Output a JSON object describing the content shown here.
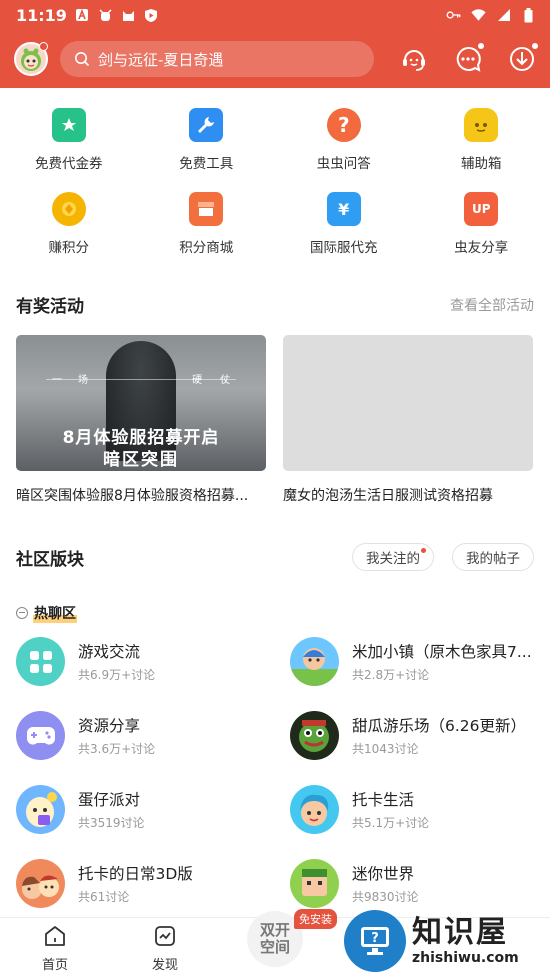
{
  "status": {
    "time": "11:19"
  },
  "search": {
    "placeholder": "剑与远征-夏日奇遇"
  },
  "quick_items": [
    {
      "label": "免费代金券",
      "color": "#26c28a"
    },
    {
      "label": "免费工具",
      "color": "#2f8ef2"
    },
    {
      "label": "虫虫问答",
      "color": "#f26a3d"
    },
    {
      "label": "辅助箱",
      "color": "#f5c518"
    },
    {
      "label": "赚积分",
      "color": "#f5b400"
    },
    {
      "label": "积分商城",
      "color": "#f2703d"
    },
    {
      "label": "国际服代充",
      "color": "#2f9df2"
    },
    {
      "label": "虫友分享",
      "color": "#f2603d"
    }
  ],
  "activities": {
    "title": "有奖活动",
    "view_all": "查看全部活动",
    "items": [
      {
        "caption": "暗区突围体验服8月体验服资格招募...",
        "poster_headline": "8月体验服招募开启",
        "poster_game": "暗区突围",
        "poster_chars": [
          "一",
          "场",
          "硬",
          "仗"
        ]
      },
      {
        "caption": "魔女的泡汤生活日服测试资格招募"
      }
    ]
  },
  "community": {
    "title": "社区版块",
    "pill_following": "我关注的",
    "pill_posts": "我的帖子",
    "hot_label": "热聊区",
    "forums": [
      {
        "name": "游戏交流",
        "meta": "共6.9万+讨论"
      },
      {
        "name": "米加小镇（原木色家具7...",
        "meta": "共2.8万+讨论"
      },
      {
        "name": "资源分享",
        "meta": "共3.6万+讨论"
      },
      {
        "name": "甜瓜游乐场（6.26更新）",
        "meta": "共1043讨论"
      },
      {
        "name": "蛋仔派对",
        "meta": "共3519讨论"
      },
      {
        "name": "托卡生活",
        "meta": "共5.1万+讨论"
      },
      {
        "name": "托卡的日常3D版",
        "meta": "共61讨论"
      },
      {
        "name": "迷你世界",
        "meta": "共9830讨论"
      }
    ]
  },
  "bottom_nav": {
    "home": "首页",
    "discover": "发现",
    "dual_line1": "双开",
    "dual_line2": "空间",
    "free_badge": "免安装"
  },
  "watermark": {
    "cn": "知识屋",
    "en": "zhishiwu.com"
  },
  "colors": {
    "brand": "#e5533f"
  }
}
